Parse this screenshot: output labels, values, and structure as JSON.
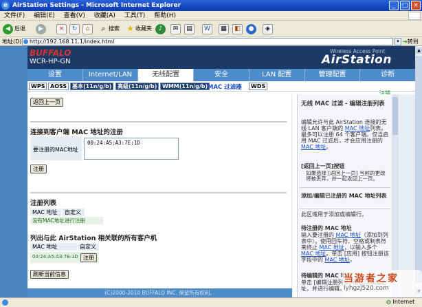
{
  "window": {
    "title": "AirStation Settings - Microsoft Internet Explorer"
  },
  "menu": [
    "文件(F)",
    "编辑(E)",
    "查看(V)",
    "收藏(A)",
    "工具(T)",
    "帮助(H)"
  ],
  "toolbar": {
    "back": "后退",
    "search": "搜索",
    "favorites": "收藏夹"
  },
  "address": {
    "label": "地址(D)",
    "url": "http://192.168.11.1/index.html",
    "go": "转到"
  },
  "brand": {
    "logo": "BUFFALO",
    "model": "WCR-HP-GN",
    "tagline": "Wireless Access Point",
    "name": "AirStation"
  },
  "nav": [
    "设置",
    "Internet/LAN",
    "无线配置",
    "安全",
    "LAN 配置",
    "管理配置",
    "诊断"
  ],
  "subnav": [
    "WPS",
    "AOSS",
    "基本(11n/g/b)",
    "高级(11n/g/b)",
    "WMM(11n/g/b)",
    "MAC 过滤器",
    "WDS"
  ],
  "logout": "注销",
  "back_button": "返回上一页",
  "register_section": {
    "title": "连接到客户端 MAC 地址的注册",
    "field_label": "要注册的MAC地址",
    "mac_value": "00:24:A5:A3:7E:1D",
    "submit": "注册"
  },
  "reg_list": {
    "title": "注册列表",
    "headers": [
      "MAC 地址",
      "自定义"
    ],
    "empty_note": "没有MAC地址进行注册"
  },
  "associated": {
    "title": "列出与此 AirStation 相关联的所有客户机",
    "headers": [
      "MAC 地址",
      "自定义"
    ],
    "rows": [
      {
        "mac": "00:24:A5:A3:7E:1D",
        "action": "注册"
      }
    ],
    "refresh": "刷新当前信息"
  },
  "footer": "(C)2000-2010 BUFFALO INC. 保留所有权利。",
  "help": {
    "title": "无线 MAC 过滤 - 编辑注册列表",
    "p1a": "编辑允许与此 AirStation 连接的无线 LAN 客户端的 ",
    "p1link1": "MAC 地址",
    "p1b": "列表。最多可以注册 64 个客户端。仅当启用 MAC 过滤后，才会应用注册的 ",
    "p1link2": "MAC 地址",
    "p1c": "。",
    "backbtn_title": "[返回上一页]按钮",
    "backbtn_text": "如果选择 [返回上一页] 当前的更改将被丢弃，并一起返回上一页。",
    "add_title": "添加/编辑已注册的 MAC 地址列表",
    "add_text": "此区域用于添加或编辑行。",
    "pending_title": "待注册的 MAC 地址",
    "pending_a": "输入要注册的 ",
    "pending_link1": "MAC 地址",
    "pending_b": "（添加到列表中）。使用回车符、空格或制表符来终止 ",
    "pending_link2": "MAC 地址",
    "pending_c": "，以输入多个 ",
    "pending_link3": "MAC 地址",
    "pending_d": "。单击 [应用] 按钮注册该字段中的 ",
    "pending_link4": "MAC 地址",
    "pending_e": "。",
    "edit_title": "待编辑的 MAC 地址",
    "edit_text": "单击 [编辑注册列表] 按钮以添加地址，并进行编辑。"
  },
  "watermark": {
    "line1": "当游者之家",
    "line2": "lyhgzj520.com"
  },
  "status": {
    "zone": "Internet"
  }
}
